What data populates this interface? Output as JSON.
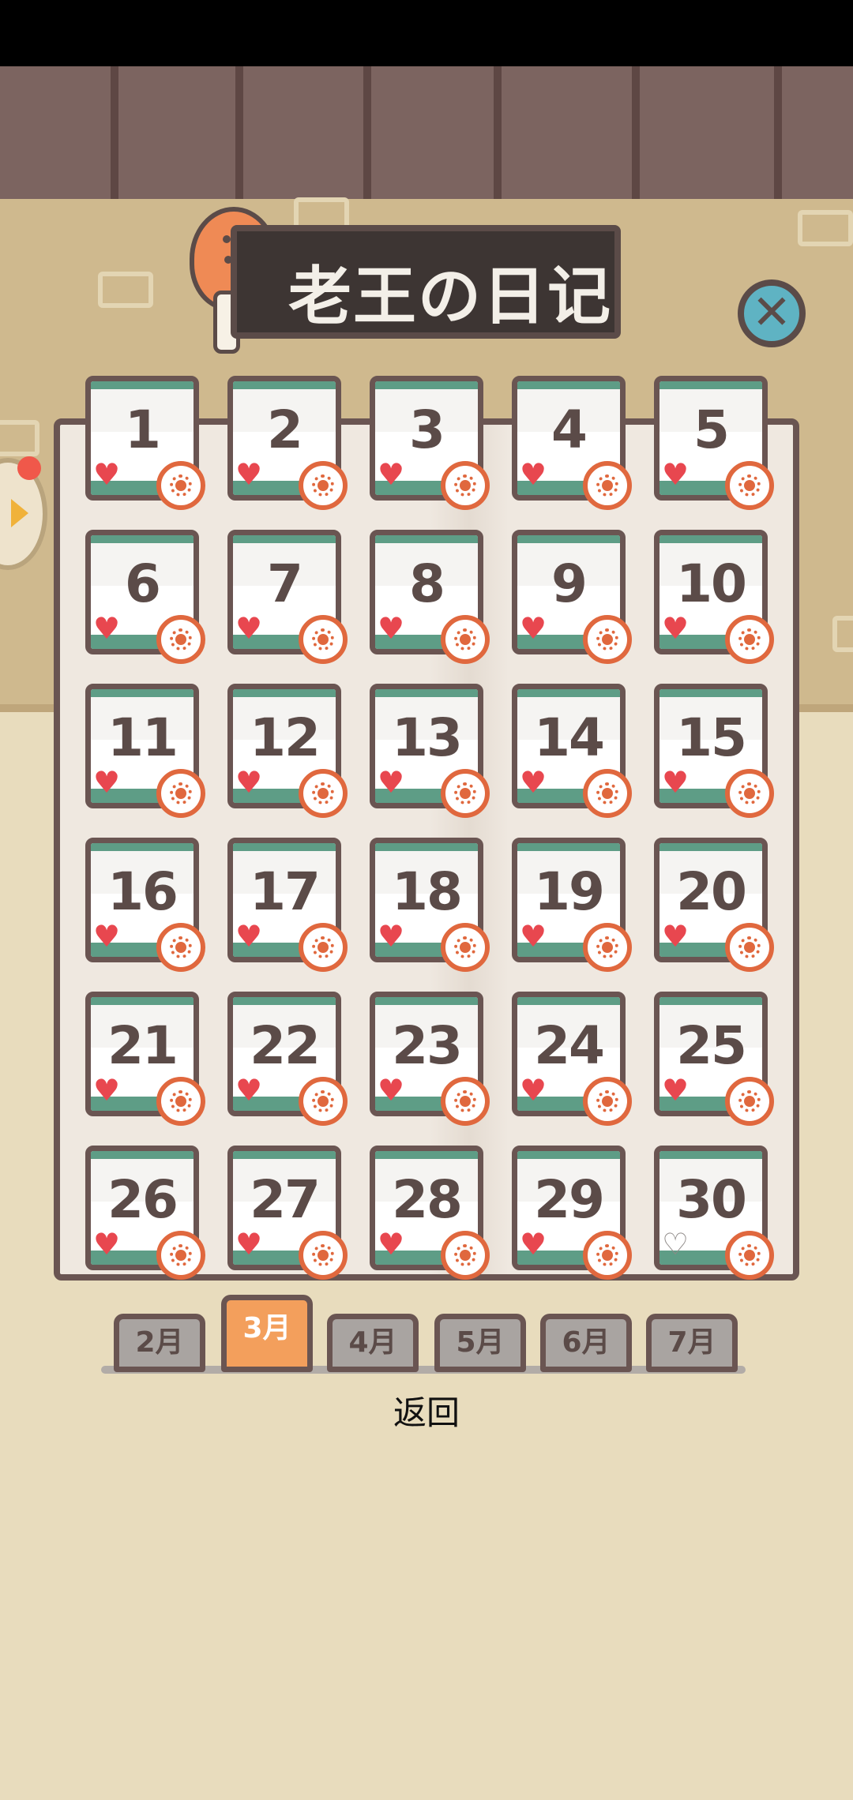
{
  "title": "老王の日记",
  "close_icon": "close-icon",
  "days": [
    {
      "num": "1",
      "mood": "heart",
      "weather": "sun"
    },
    {
      "num": "2",
      "mood": "heart",
      "weather": "sun"
    },
    {
      "num": "3",
      "mood": "heart",
      "weather": "sun"
    },
    {
      "num": "4",
      "mood": "heart",
      "weather": "sun"
    },
    {
      "num": "5",
      "mood": "heart",
      "weather": "sun"
    },
    {
      "num": "6",
      "mood": "heart",
      "weather": "sun"
    },
    {
      "num": "7",
      "mood": "heart",
      "weather": "sun"
    },
    {
      "num": "8",
      "mood": "heart",
      "weather": "sun"
    },
    {
      "num": "9",
      "mood": "heart",
      "weather": "sun"
    },
    {
      "num": "10",
      "mood": "heart",
      "weather": "sun"
    },
    {
      "num": "11",
      "mood": "heart",
      "weather": "sun"
    },
    {
      "num": "12",
      "mood": "heart",
      "weather": "sun"
    },
    {
      "num": "13",
      "mood": "heart",
      "weather": "sun"
    },
    {
      "num": "14",
      "mood": "heart",
      "weather": "sun"
    },
    {
      "num": "15",
      "mood": "heart",
      "weather": "sun"
    },
    {
      "num": "16",
      "mood": "heart",
      "weather": "sun"
    },
    {
      "num": "17",
      "mood": "heart",
      "weather": "sun"
    },
    {
      "num": "18",
      "mood": "heart",
      "weather": "sun"
    },
    {
      "num": "19",
      "mood": "heart",
      "weather": "sun"
    },
    {
      "num": "20",
      "mood": "heart",
      "weather": "sun"
    },
    {
      "num": "21",
      "mood": "heart",
      "weather": "sun"
    },
    {
      "num": "22",
      "mood": "heart",
      "weather": "sun"
    },
    {
      "num": "23",
      "mood": "heart",
      "weather": "sun"
    },
    {
      "num": "24",
      "mood": "heart",
      "weather": "sun"
    },
    {
      "num": "25",
      "mood": "heart",
      "weather": "sun"
    },
    {
      "num": "26",
      "mood": "heart",
      "weather": "sun"
    },
    {
      "num": "27",
      "mood": "heart",
      "weather": "sun"
    },
    {
      "num": "28",
      "mood": "heart",
      "weather": "sun"
    },
    {
      "num": "29",
      "mood": "heart",
      "weather": "sun"
    },
    {
      "num": "30",
      "mood": "broken-heart",
      "weather": "sun"
    }
  ],
  "tabs": [
    {
      "label": "2月",
      "active": false
    },
    {
      "label": "3月",
      "active": true
    },
    {
      "label": "4月",
      "active": false
    },
    {
      "label": "5月",
      "active": false
    },
    {
      "label": "6月",
      "active": false
    },
    {
      "label": "7月",
      "active": false
    }
  ],
  "back_label": "返回",
  "colors": {
    "active_tab": "#f39f5c",
    "heart": "#e8474f",
    "sun": "#e0683e",
    "card_trim": "#5e9d86"
  }
}
